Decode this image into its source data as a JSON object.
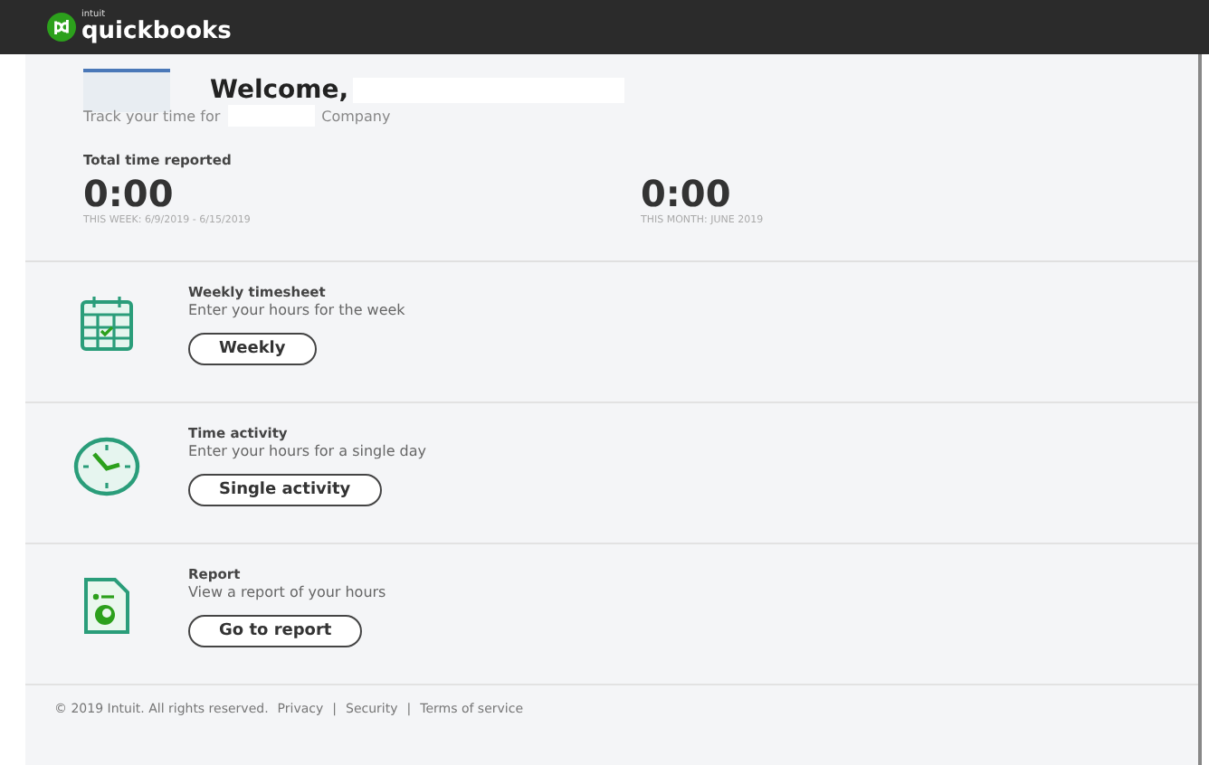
{
  "header": {
    "logo_small": "intuit",
    "logo": "quickbooks"
  },
  "welcome": {
    "title": "Welcome,",
    "subtitle_before": "Track your time for",
    "subtitle_after": "Company"
  },
  "totals": {
    "label": "Total time reported",
    "items": [
      {
        "value": "0:00",
        "caption": "THIS WEEK: 6/9/2019 - 6/15/2019"
      },
      {
        "value": "0:00",
        "caption": "THIS MONTH: JUNE 2019"
      }
    ]
  },
  "actions": [
    {
      "kind": "calendar",
      "title": "Weekly timesheet",
      "description": "Enter your hours for the week",
      "button": "Weekly"
    },
    {
      "kind": "clock",
      "title": "Time activity",
      "description": "Enter your hours for a single day",
      "button": "Single activity"
    },
    {
      "kind": "report",
      "title": "Report",
      "description": "View a report of your hours",
      "button": "Go to report"
    }
  ],
  "footer": {
    "copyright": "© 2019 Intuit. All rights reserved.",
    "separator": "|",
    "links": [
      "Privacy",
      "Security",
      "Terms of service"
    ]
  }
}
